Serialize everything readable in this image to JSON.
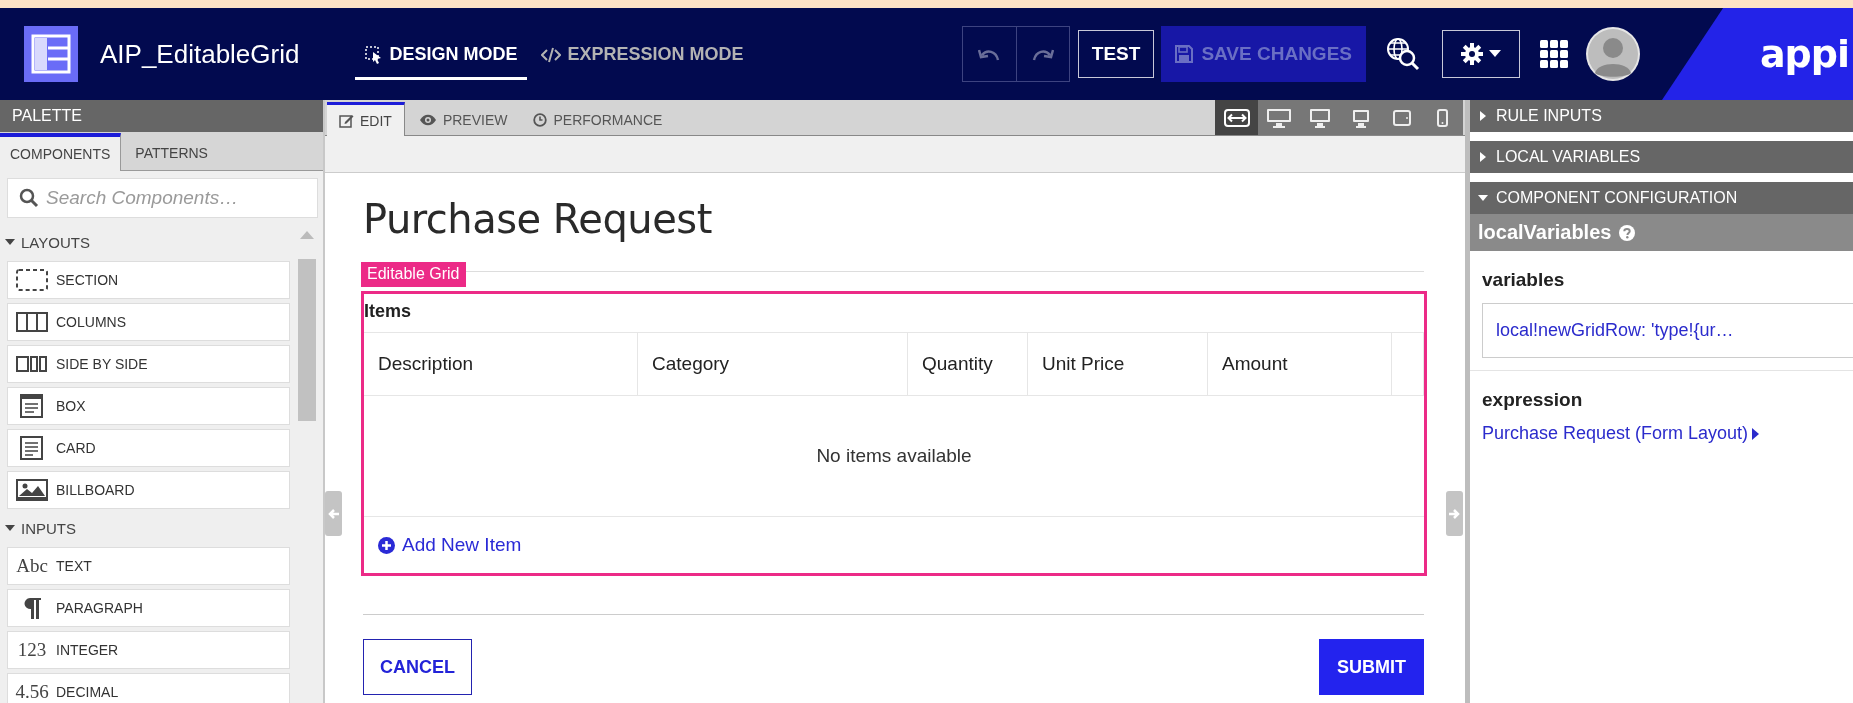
{
  "header": {
    "app_title": "AIP_EditableGrid",
    "modes": [
      {
        "label": "DESIGN MODE",
        "selected": true,
        "kind": "design"
      },
      {
        "label": "EXPRESSION MODE",
        "selected": false,
        "kind": "expression"
      }
    ],
    "test_button": "TEST",
    "save_button": {
      "label": "SAVE CHANGES",
      "disabled": true
    },
    "logo_text": "appi"
  },
  "palette": {
    "title": "PALETTE",
    "tabs": [
      {
        "label": "COMPONENTS",
        "selected": true
      },
      {
        "label": "PATTERNS",
        "selected": false
      }
    ],
    "search": {
      "placeholder": "Search Components…"
    },
    "groups": [
      {
        "label": "LAYOUTS",
        "expanded": true,
        "items": [
          {
            "label": "SECTION",
            "kind": "section"
          },
          {
            "label": "COLUMNS",
            "kind": "columns"
          },
          {
            "label": "SIDE BY SIDE",
            "kind": "side-by-side"
          },
          {
            "label": "BOX",
            "kind": "box"
          },
          {
            "label": "CARD",
            "kind": "card"
          },
          {
            "label": "BILLBOARD",
            "kind": "billboard"
          }
        ]
      },
      {
        "label": "INPUTS",
        "expanded": true,
        "items": [
          {
            "label": "TEXT",
            "kind": "glyph",
            "glyph": "Abc"
          },
          {
            "label": "PARAGRAPH",
            "kind": "paragraph"
          },
          {
            "label": "INTEGER",
            "kind": "glyph",
            "glyph": "123"
          },
          {
            "label": "DECIMAL",
            "kind": "glyph",
            "glyph": "4.56"
          }
        ]
      }
    ]
  },
  "editor": {
    "tabs": [
      {
        "label": "EDIT",
        "selected": true,
        "kind": "edit"
      },
      {
        "label": "PREVIEW",
        "selected": false,
        "kind": "preview"
      },
      {
        "label": "PERFORMANCE",
        "selected": false,
        "kind": "performance"
      }
    ],
    "devices": [
      {
        "kind": "fit",
        "selected": true
      },
      {
        "kind": "desktop-wide",
        "selected": false
      },
      {
        "kind": "desktop",
        "selected": false
      },
      {
        "kind": "monitor",
        "selected": false
      },
      {
        "kind": "tablet",
        "selected": false
      },
      {
        "kind": "phone",
        "selected": false
      }
    ]
  },
  "form": {
    "title": "Purchase Request",
    "grid": {
      "tag": "Editable Grid",
      "label": "Items",
      "columns": [
        "Description",
        "Category",
        "Quantity",
        "Unit Price",
        "Amount"
      ],
      "empty_text": "No items available",
      "add_link": "Add New Item"
    },
    "buttons": [
      {
        "label": "CANCEL",
        "kind": "secondary"
      },
      {
        "label": "SUBMIT",
        "kind": "primary"
      }
    ]
  },
  "config": {
    "sections": [
      {
        "label": "RULE INPUTS",
        "expanded": false
      },
      {
        "label": "LOCAL VARIABLES",
        "expanded": false
      },
      {
        "label": "COMPONENT CONFIGURATION",
        "expanded": true
      }
    ],
    "component_name": "localVariables",
    "fields": [
      {
        "label": "variables",
        "kind": "field",
        "value": "local!newGridRow: 'type!{ur…"
      },
      {
        "label": "expression",
        "kind": "link",
        "value": "Purchase Request (Form Layout)"
      }
    ]
  }
}
